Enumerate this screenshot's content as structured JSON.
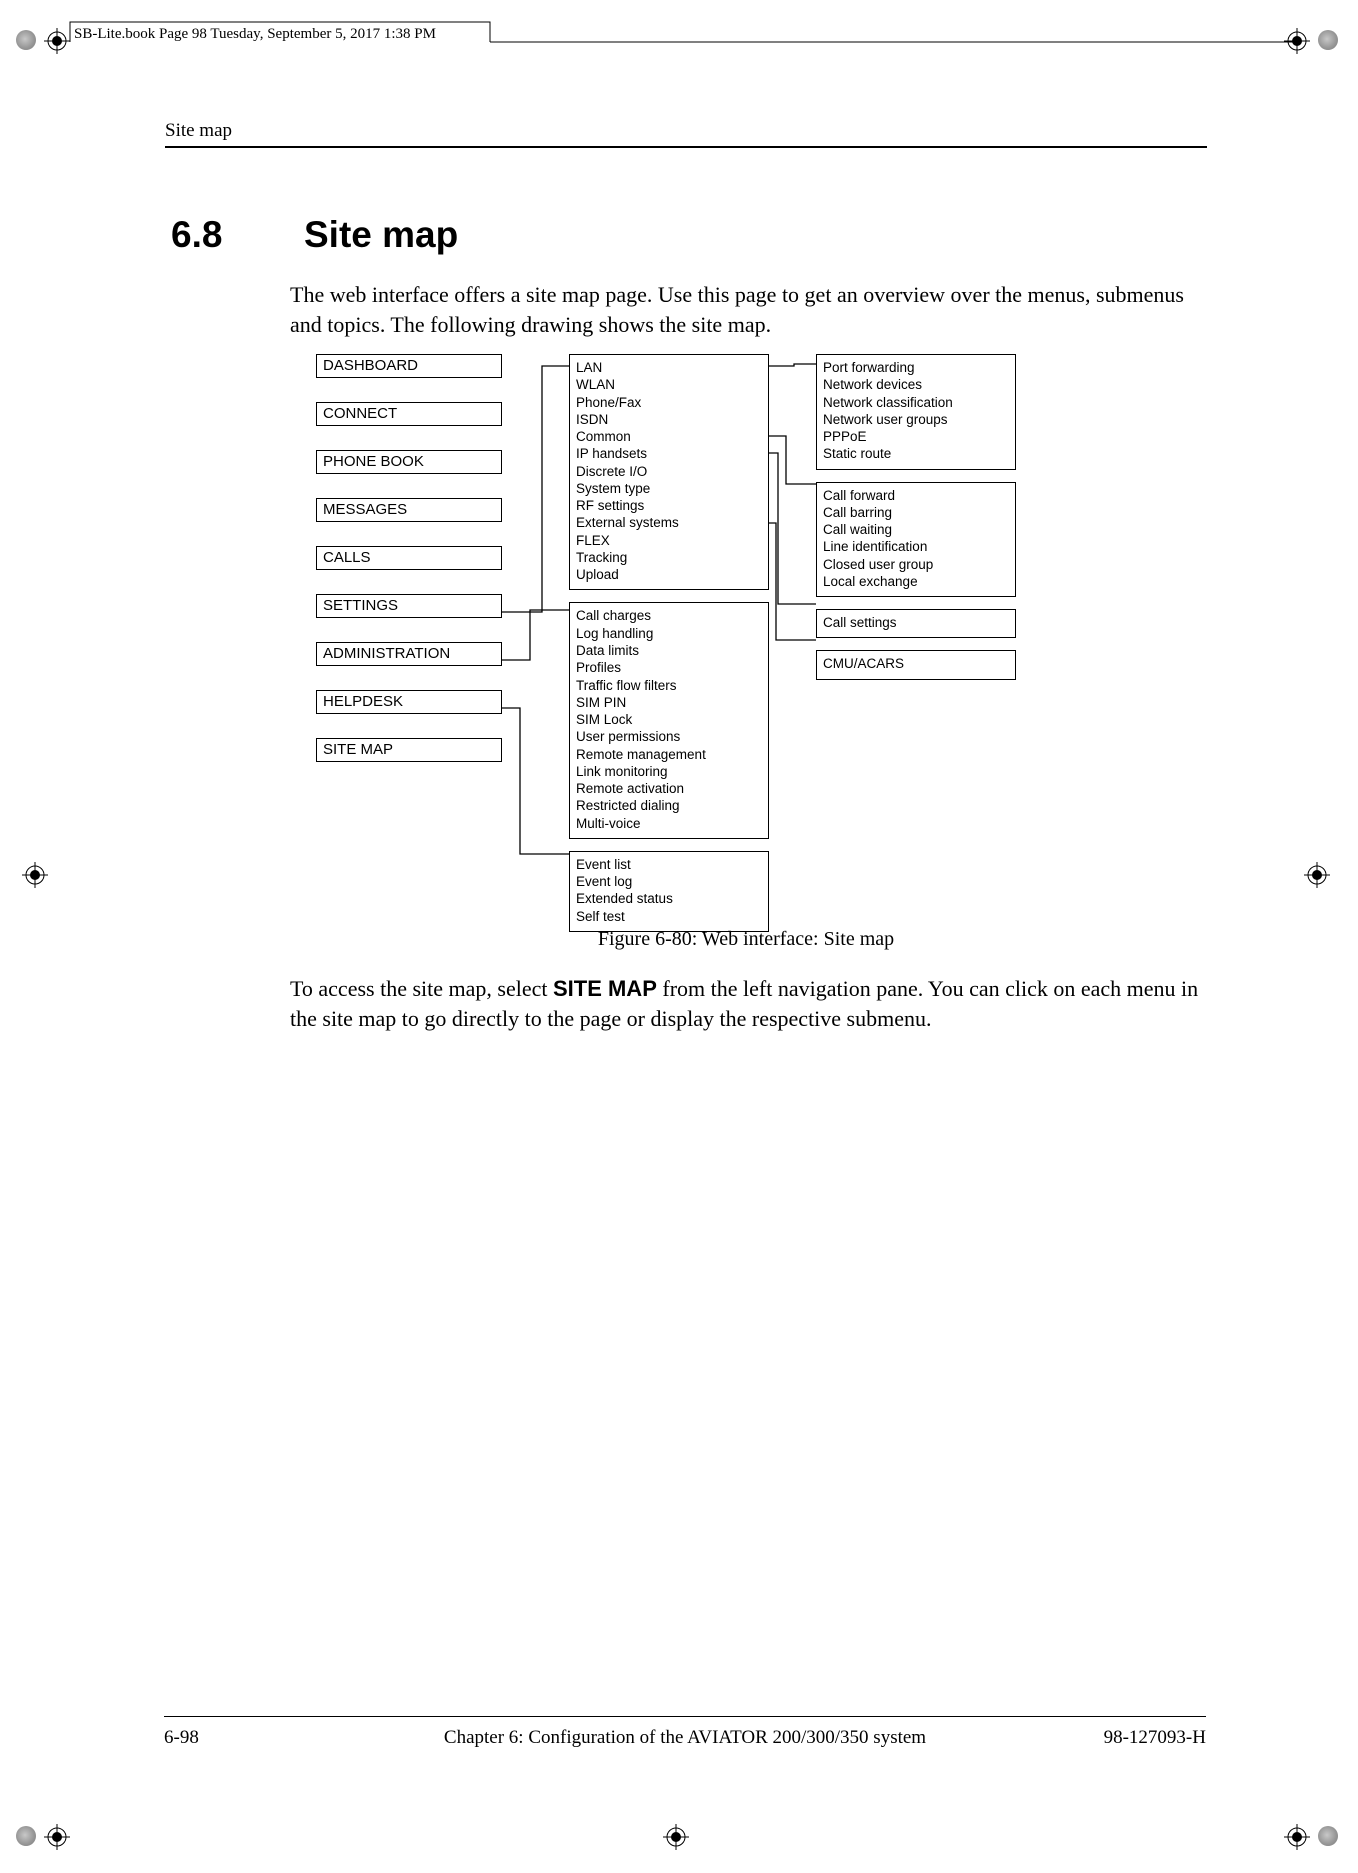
{
  "slug": "SB-Lite.book  Page 98  Tuesday, September 5, 2017  1:38 PM",
  "running_head": "Site map",
  "section": {
    "num": "6.8",
    "title": "Site map"
  },
  "intro": "The web interface offers a site map page. Use this page to get an overview over the menus, submenus and topics. The following drawing shows the site map.",
  "menu": [
    "DASHBOARD",
    "CONNECT",
    "PHONE BOOK",
    "MESSAGES",
    "CALLS",
    "SETTINGS",
    "ADMINISTRATION",
    "HELPDESK",
    "SITE MAP"
  ],
  "settings_box": [
    "LAN",
    "WLAN",
    "Phone/Fax",
    "ISDN",
    "Common",
    "IP handsets",
    "Discrete I/O",
    "System type",
    "RF settings",
    "External systems",
    "FLEX",
    "Tracking",
    "Upload"
  ],
  "admin_box": [
    "Call charges",
    "Log handling",
    "Data limits",
    "Profiles",
    "Traffic flow filters",
    "SIM PIN",
    "SIM Lock",
    "User permissions",
    "Remote management",
    "Link monitoring",
    "Remote activation",
    "Restricted dialing",
    "Multi-voice"
  ],
  "helpdesk_box": [
    "Event list",
    "Event log",
    "Extended status",
    "Self test"
  ],
  "lan_box": [
    "Port forwarding",
    "Network devices",
    "Network classification",
    "Network user groups",
    "PPPoE",
    "Static route"
  ],
  "common_box": [
    "Call forward",
    "Call barring",
    "Call waiting",
    "Line identification",
    "Closed user group",
    "Local exchange"
  ],
  "iphandsets_box": [
    "Call settings"
  ],
  "ext_box": [
    "CMU/ACARS"
  ],
  "caption": "Figure 6-80: Web interface: Site map",
  "access": {
    "pre": "To access the site map, select ",
    "bold": "SITE MAP",
    "post": " from the left navigation pane. You can click on each menu in the site map to go directly to the page or display the respective submenu."
  },
  "footer": {
    "left": "6-98",
    "center": "Chapter 6:  Configuration of the AVIATOR 200/300/350 system",
    "right": "98-127093-H"
  }
}
